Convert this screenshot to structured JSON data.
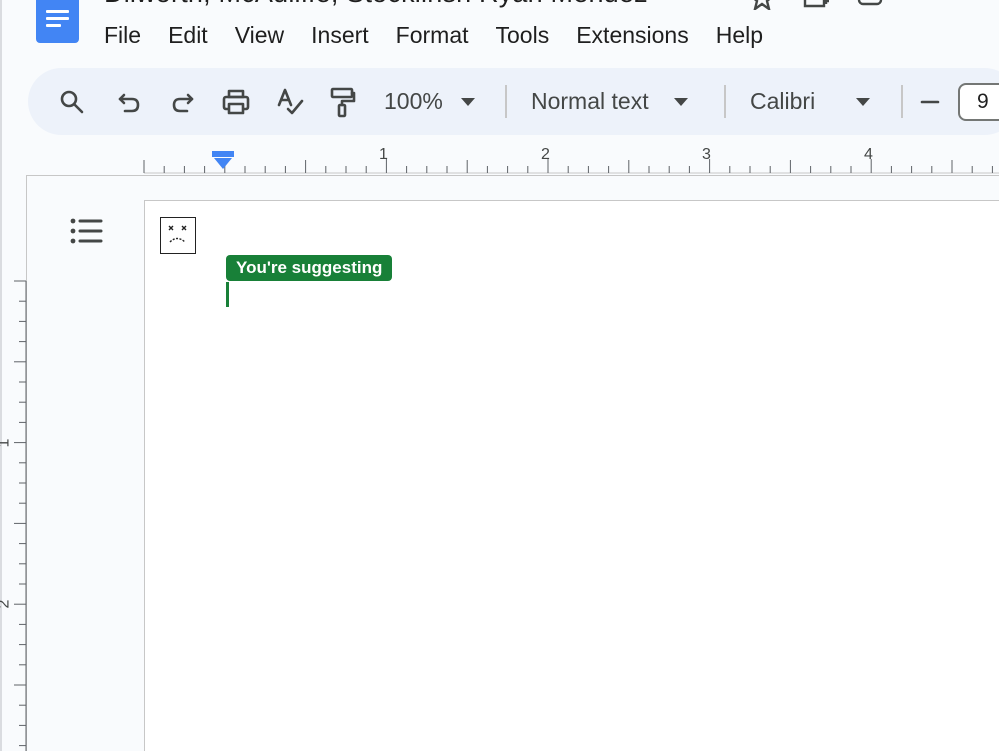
{
  "document": {
    "title": "Dilworth, McAuliffe, Stocklinsh Ryan Mendez"
  },
  "menu": [
    "File",
    "Edit",
    "View",
    "Insert",
    "Format",
    "Tools",
    "Extensions",
    "Help"
  ],
  "toolbar": {
    "zoom": "100%",
    "paragraph_style": "Normal text",
    "font": "Calibri",
    "font_size": "9",
    "icons": [
      "search-icon",
      "undo-icon",
      "redo-icon",
      "print-icon",
      "spellcheck-icon",
      "paint-format-icon"
    ]
  },
  "ruler": {
    "horizontal_labels": [
      "1",
      "2",
      "3",
      "4"
    ],
    "vertical_labels": [
      "1",
      "2"
    ]
  },
  "editor": {
    "mode_chip": "You're suggesting"
  },
  "colors": {
    "accent_blue": "#4285f4",
    "suggesting_green": "#188038",
    "toolbar_bg": "#edf2fa"
  }
}
